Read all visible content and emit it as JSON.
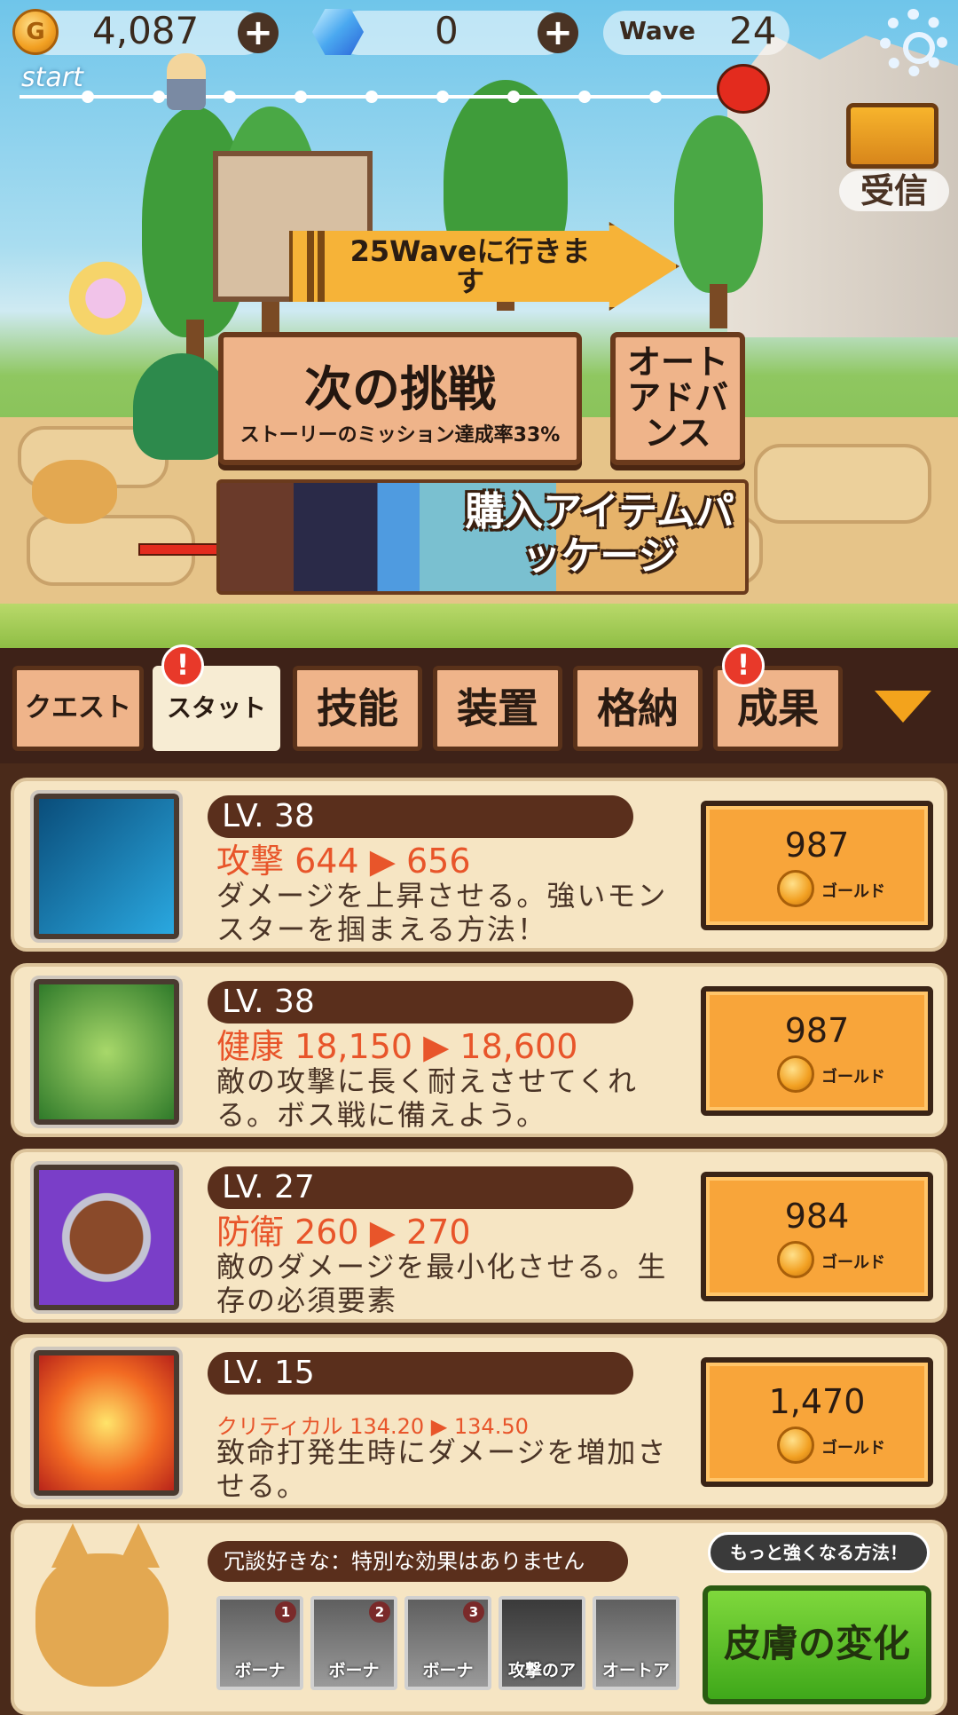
{
  "hud": {
    "gold": "4,087",
    "gems": "0",
    "wave_label": "Wave",
    "wave_number": "24",
    "progress_start": "start"
  },
  "reward": {
    "label": "受信"
  },
  "scene": {
    "next_wave": "25Waveに行きます",
    "challenge_title": "次の挑戦",
    "challenge_sub": "ストーリーのミッション達成率33%",
    "auto_advance": "オートアドバンス",
    "package_banner": "購入アイテムパッケージ"
  },
  "tabs": [
    {
      "label": "クエスト",
      "badge": ""
    },
    {
      "label": "スタット",
      "badge": "!"
    },
    {
      "label": "技能",
      "badge": ""
    },
    {
      "label": "装置",
      "badge": ""
    },
    {
      "label": "格納",
      "badge": ""
    },
    {
      "label": "成果",
      "badge": "!"
    }
  ],
  "stats": [
    {
      "level": "LV. 38",
      "stat": "攻撃 644 ▶ 656",
      "desc": "ダメージを上昇させる。強いモンスターを掴まえる方法！",
      "price": "987",
      "currency": "ゴールド",
      "icon": "sword-icon"
    },
    {
      "level": "LV. 38",
      "stat": "健康 18,150 ▶ 18,600",
      "desc": "敵の攻撃に長く耐えさせてくれる。ボス戦に備えよう。",
      "price": "987",
      "currency": "ゴールド",
      "icon": "hero-icon"
    },
    {
      "level": "LV. 27",
      "stat": "防衛 260 ▶ 270",
      "desc": "敵のダメージを最小化させる。生存の必須要素",
      "price": "984",
      "currency": "ゴールド",
      "icon": "shield-icon"
    },
    {
      "level": "LV. 15",
      "stat": "クリティカル 134.20 ▶ 134.50",
      "desc": "致命打発生時にダメージを増加させる。",
      "price": "1,470",
      "currency": "ゴールド",
      "icon": "critical-sword-icon"
    }
  ],
  "pet": {
    "effect": "冗談好きな：特別な効果はありません",
    "slots": [
      {
        "label": "ボーナ",
        "num": "1"
      },
      {
        "label": "ボーナ",
        "num": "2"
      },
      {
        "label": "ボーナ",
        "num": "3"
      },
      {
        "label": "攻撃のア",
        "num": ""
      },
      {
        "label": "オートア",
        "num": ""
      }
    ],
    "tip": "もっと強くなる方法！",
    "skin_button": "皮膚の変化"
  },
  "colors": {
    "accent": "#f8a53a",
    "panel": "#4a2a1a",
    "card": "#f6e5c3",
    "stat_text": "#e8552a"
  }
}
